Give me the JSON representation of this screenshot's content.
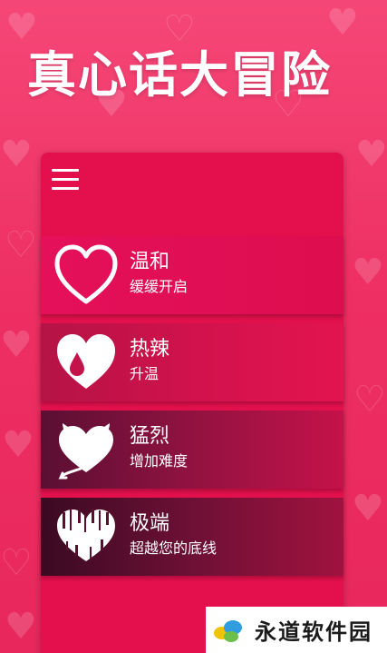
{
  "app": {
    "title": "真心话大冒险"
  },
  "menu": {
    "icon": "hamburger-menu-icon"
  },
  "levels": [
    {
      "name": "温和",
      "description": "缓缓开启",
      "icon": "heart-outline-icon"
    },
    {
      "name": "热辣",
      "description": "升温",
      "icon": "heart-drop-icon"
    },
    {
      "name": "猛烈",
      "description": "增加难度",
      "icon": "devil-heart-icon"
    },
    {
      "name": "极端",
      "description": "超越您的底线",
      "icon": "glitch-heart-icon"
    }
  ],
  "watermark": {
    "text": "永道软件园",
    "icon": "leaf-logo-icon"
  },
  "colors": {
    "background": "#f0336a",
    "card": "#e3104d",
    "text": "#ffffff"
  }
}
